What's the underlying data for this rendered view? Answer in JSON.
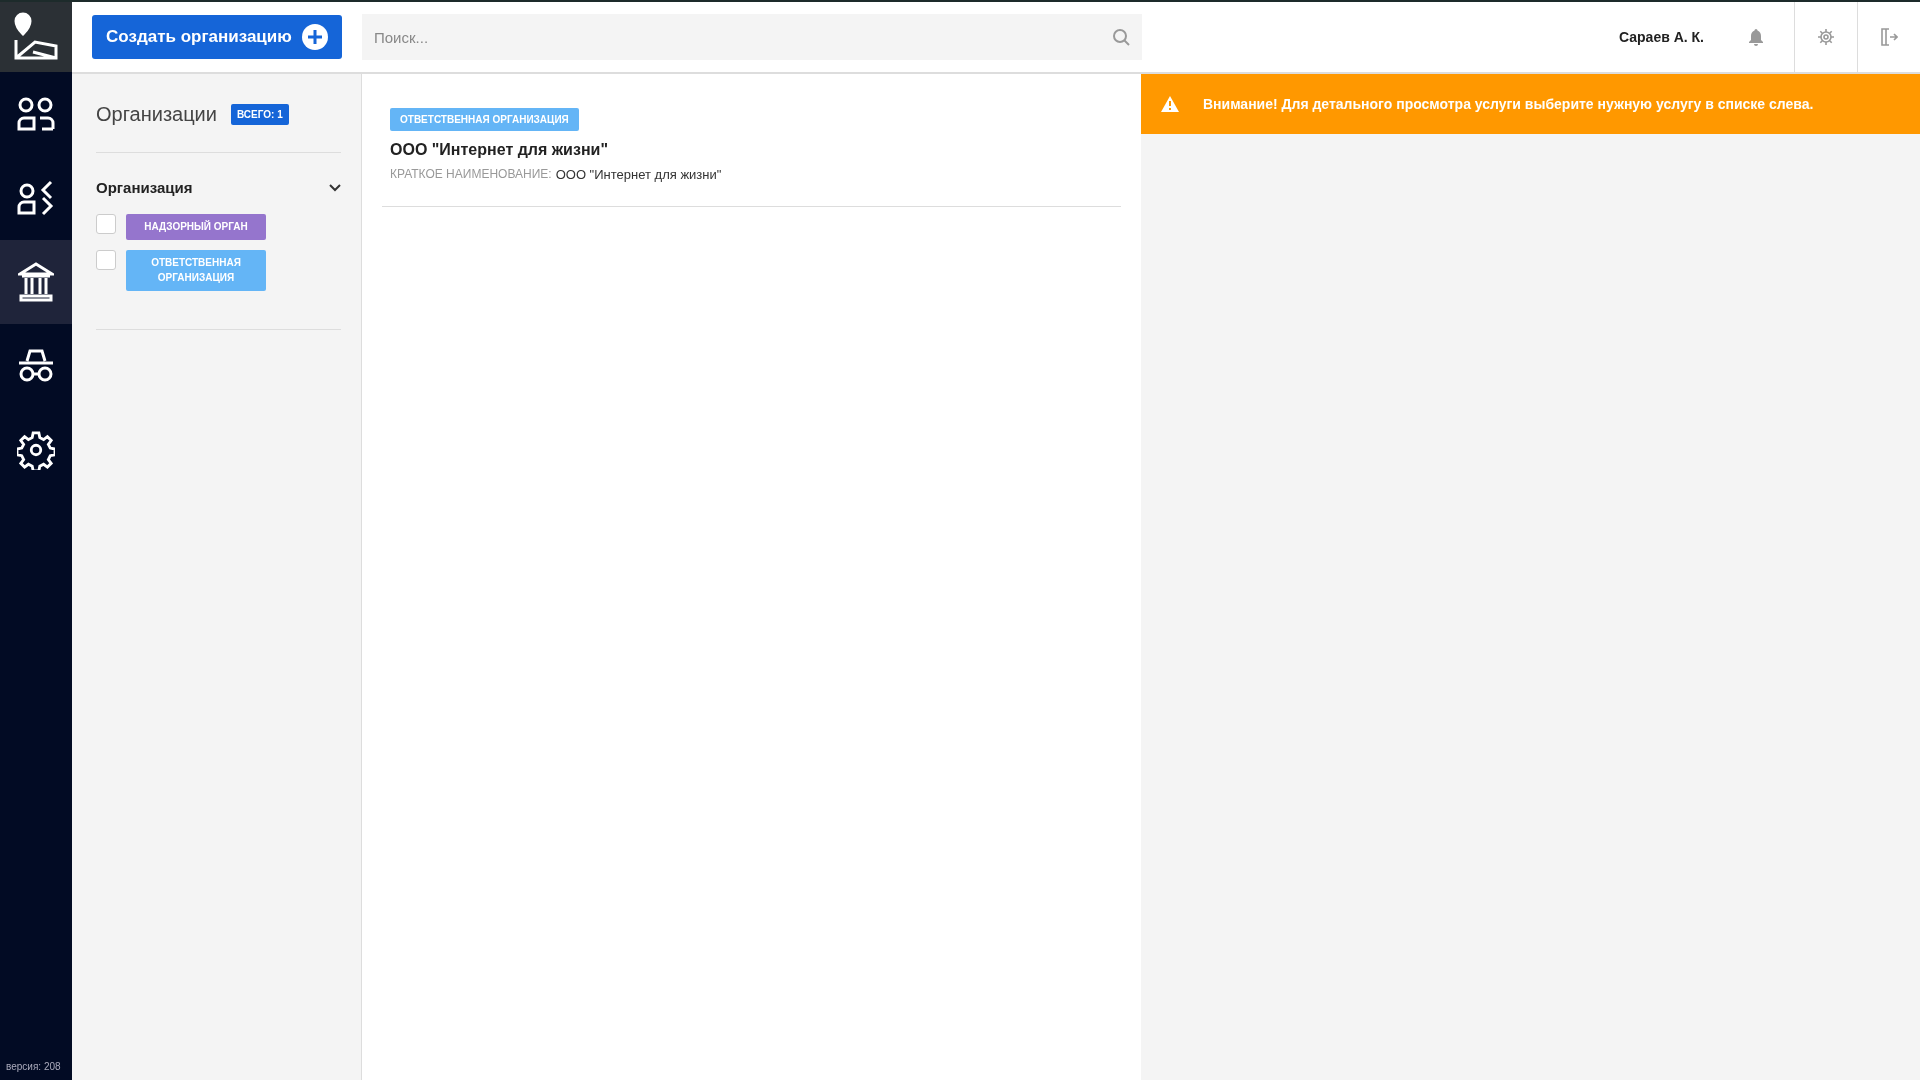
{
  "sidebar": {
    "items": [
      {
        "kind": "users",
        "selected": false
      },
      {
        "kind": "user-switch",
        "selected": false
      },
      {
        "kind": "bank",
        "selected": true
      },
      {
        "kind": "spy",
        "selected": false
      },
      {
        "kind": "settings",
        "selected": false
      }
    ],
    "version": "версия: 208"
  },
  "top_bar": {
    "create_button": "Создать организацию",
    "search": {
      "placeholder": "Поиск..."
    },
    "user": "Сараев А. К."
  },
  "filter_panel": {
    "title": "Организации",
    "total_badge": "ВСЕГО: 1",
    "group": {
      "title": "Организация",
      "expanded": true,
      "options": [
        {
          "label": "НАДЗОРНЫЙ ОРГАН",
          "checked": false,
          "color": "#9575cd"
        },
        {
          "label": "ОТВЕТСТВЕННАЯ ОРГАНИЗАЦИЯ",
          "checked": false,
          "color": "#64b5f6"
        }
      ]
    }
  },
  "list": {
    "items": [
      {
        "tag": "ОТВЕТСТВЕННАЯ ОРГАНИЗАЦИЯ",
        "color": "#64b5f6",
        "name": "ООО \"Интернет для жизни\"",
        "short_name_label": "КРАТКОЕ НАИМЕНОВАНИЕ:",
        "short_name": "ООО \"Интернет для жизни\""
      }
    ]
  },
  "alert": {
    "text": "Внимание! Для детального просмотра услуги выберите нужную услугу в списке слева."
  }
}
